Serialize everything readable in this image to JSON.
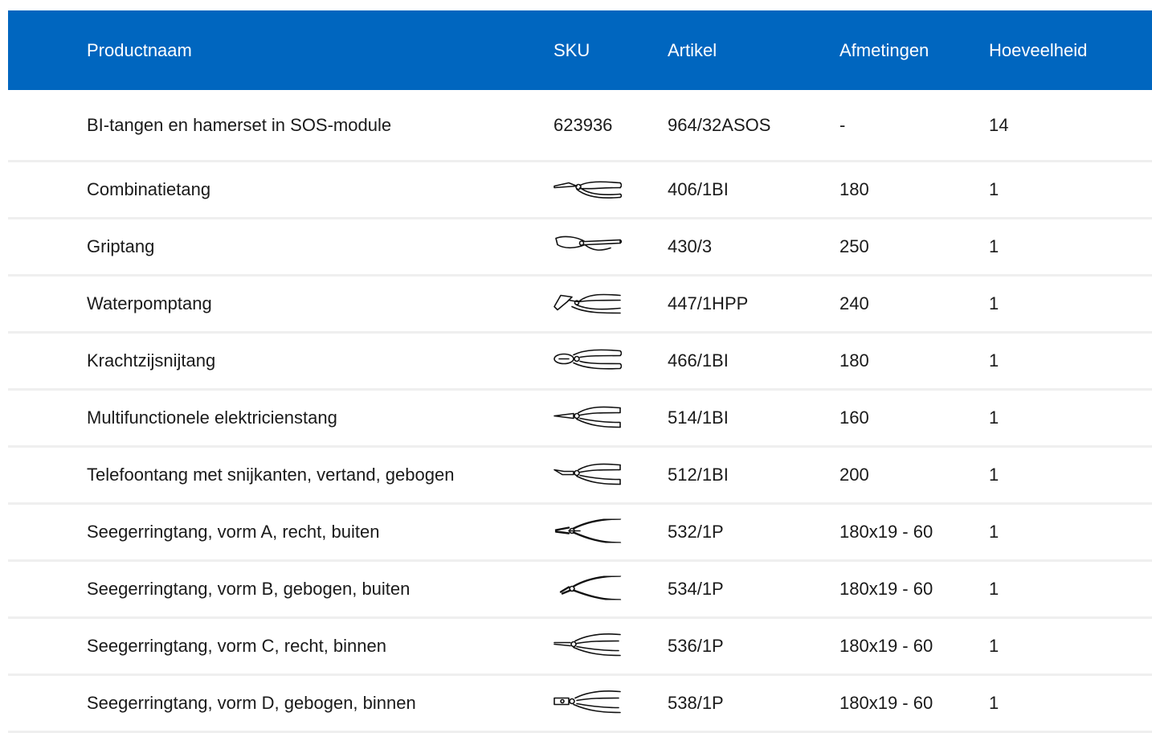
{
  "columns": {
    "name": "Productnaam",
    "sku": "SKU",
    "article": "Artikel",
    "dimensions": "Afmetingen",
    "quantity": "Hoeveelheid"
  },
  "kit": {
    "name": "BI-tangen en hamerset in SOS-module",
    "sku": "623936",
    "article": "964/32ASOS",
    "dimensions": "-",
    "quantity": "14"
  },
  "items": [
    {
      "name": "Combinatietang",
      "icon": "combination-pliers-icon",
      "article": "406/1BI",
      "dimensions": "180",
      "quantity": "1"
    },
    {
      "name": "Griptang",
      "icon": "locking-pliers-icon",
      "article": "430/3",
      "dimensions": "250",
      "quantity": "1"
    },
    {
      "name": "Waterpomptang",
      "icon": "water-pump-pliers-icon",
      "article": "447/1HPP",
      "dimensions": "240",
      "quantity": "1"
    },
    {
      "name": "Krachtzijsnijtang",
      "icon": "side-cutter-icon",
      "article": "466/1BI",
      "dimensions": "180",
      "quantity": "1"
    },
    {
      "name": "Multifunctionele elektricienstang",
      "icon": "electrician-pliers-icon",
      "article": "514/1BI",
      "dimensions": "160",
      "quantity": "1"
    },
    {
      "name": "Telefoontang met snijkanten, vertand, gebogen",
      "icon": "bent-nose-pliers-icon",
      "article": "512/1BI",
      "dimensions": "200",
      "quantity": "1"
    },
    {
      "name": "Seegerringtang, vorm A, recht, buiten",
      "icon": "circlip-pliers-icon",
      "article": "532/1P",
      "dimensions": "180x19 - 60",
      "quantity": "1"
    },
    {
      "name": "Seegerringtang, vorm B, gebogen, buiten",
      "icon": "circlip-pliers-bent-icon",
      "article": "534/1P",
      "dimensions": "180x19 - 60",
      "quantity": "1"
    },
    {
      "name": "Seegerringtang, vorm C, recht, binnen",
      "icon": "circlip-pliers-internal-icon",
      "article": "536/1P",
      "dimensions": "180x19 - 60",
      "quantity": "1"
    },
    {
      "name": "Seegerringtang, vorm D, gebogen, binnen",
      "icon": "circlip-pliers-internal-bent-icon",
      "article": "538/1P",
      "dimensions": "180x19 - 60",
      "quantity": "1"
    }
  ],
  "colors": {
    "header_bg": "#0066bf",
    "header_text": "#ffffff",
    "row_divider": "#efefef"
  }
}
